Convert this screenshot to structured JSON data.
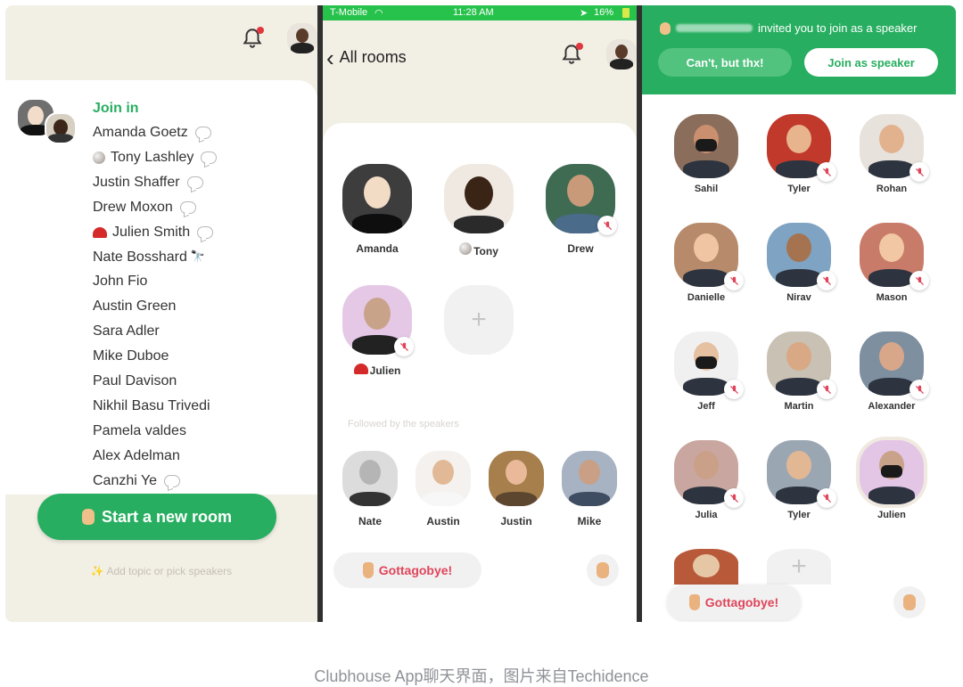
{
  "caption": "Clubhouse App聊天界面，图片来自Techidence",
  "colors": {
    "accent_green": "#27ae60",
    "danger_red": "#e0455a",
    "background_beige": "#f2efe4"
  },
  "panel1": {
    "join_in_label": "Join in",
    "people": [
      {
        "name": "Amanda Goetz",
        "badge": "chat-bubble-icon"
      },
      {
        "name": "Tony Lashley",
        "prefix": "coin-emoji",
        "badge": "chat-bubble-icon"
      },
      {
        "name": "Justin Shaffer",
        "badge": "chat-bubble-icon"
      },
      {
        "name": "Drew Moxon",
        "badge": "chat-bubble-icon"
      },
      {
        "name": "Julien Smith",
        "prefix": "red-cap-emoji",
        "badge": "chat-bubble-icon"
      },
      {
        "name": "Nate Bosshard",
        "badge": "telescope-emoji"
      },
      {
        "name": "John Fio"
      },
      {
        "name": "Austin Green"
      },
      {
        "name": "Sara Adler"
      },
      {
        "name": "Mike Duboe"
      },
      {
        "name": "Paul Davison"
      },
      {
        "name": "Nikhil Basu Trivedi"
      },
      {
        "name": "Pamela valdes"
      },
      {
        "name": "Alex Adelman"
      },
      {
        "name": "Canzhi Ye",
        "badge": "chat-bubble-icon"
      }
    ],
    "start_room_label": "Start a new room",
    "add_topic_label": "Add topic or pick speakers"
  },
  "panel2": {
    "status_carrier": "T-Mobile",
    "status_time": "11:28 AM",
    "status_battery": "16%",
    "back_label": "All rooms",
    "speakers": [
      {
        "name": "Amanda",
        "muted": false
      },
      {
        "name": "Tony",
        "muted": false
      },
      {
        "name": "Drew",
        "muted": true
      },
      {
        "name": "Julien",
        "muted": true
      }
    ],
    "followed_label": "Followed by the speakers",
    "followed": [
      "Nate",
      "Austin",
      "Justin",
      "Mike"
    ],
    "leave_label": "Gottagobye!"
  },
  "panel3": {
    "invite_text": "invited you to join as a speaker",
    "decline_label": "Can't, but thx!",
    "accept_label": "Join as speaker",
    "speakers": [
      "Sahil",
      "Tyler",
      "Rohan",
      "Danielle",
      "Nirav",
      "Mason",
      "Jeff",
      "Martin",
      "Alexander",
      "Julia",
      "Tyler",
      "Julien"
    ],
    "leave_label": "Gottagobye!"
  }
}
